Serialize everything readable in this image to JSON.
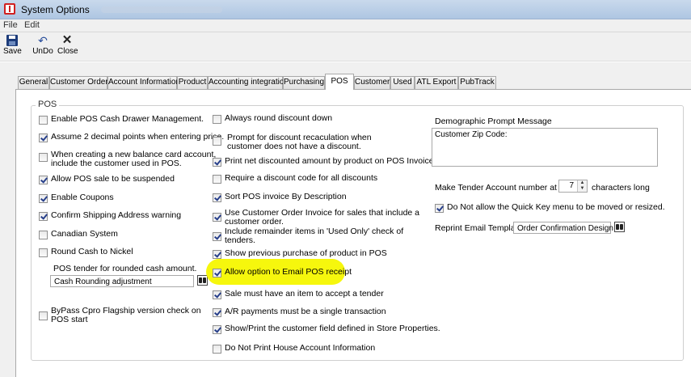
{
  "window": {
    "title": "System Options"
  },
  "menu": [
    "File",
    "Edit"
  ],
  "toolbar": {
    "save": "Save",
    "undo": "UnDo",
    "close": "Close"
  },
  "tabs": [
    "General",
    "Customer Orders",
    "Account Information",
    "Product",
    "Accounting integration",
    "Purchasing",
    "POS",
    "Customer",
    "Used",
    "ATL Export",
    "PubTrack"
  ],
  "active_tab": "POS",
  "group_title": "POS",
  "col1": {
    "enable_drawer": {
      "label": "Enable POS Cash Drawer Management.",
      "checked": false
    },
    "assume_decimal": {
      "label": "Assume 2 decimal points when entering price.",
      "checked": true
    },
    "new_balance_1": "When creating a new balance card account,",
    "new_balance_2": "include the customer used in POS.",
    "allow_suspend": {
      "label": "Allow POS sale to be suspended",
      "checked": true
    },
    "enable_coupons": {
      "label": "Enable Coupons",
      "checked": true
    },
    "confirm_shipping": {
      "label": "Confirm Shipping Address warning",
      "checked": true
    },
    "canadian": {
      "label": "Canadian System",
      "checked": false
    },
    "round_cash": {
      "label": "Round Cash to Nickel",
      "checked": false
    },
    "pos_tender_label": "POS tender for rounded cash amount.",
    "pos_tender_value": "Cash Rounding adjustment",
    "bypass_1": "ByPass Cpro Flagship  version check on",
    "bypass_2": "POS start"
  },
  "col2": {
    "always_round": {
      "label": "Always round discount down",
      "checked": false
    },
    "prompt_discount_1": "Prompt for discount recaculation when",
    "prompt_discount_2": "customer does not have a discount.",
    "print_net": {
      "label": "Print net discounted amount by product on POS Invoice",
      "checked": true
    },
    "require_code": {
      "label": "Require a discount code for all discounts",
      "checked": false
    },
    "sort_invoice": {
      "label": "Sort POS invoice By Description",
      "checked": true
    },
    "use_co_1": "Use Customer Order Invoice for sales  that include a",
    "use_co_2": "customer order.",
    "include_used_1": "Include remainder items in 'Used Only' check of",
    "include_used_2": "tenders.",
    "show_previous": {
      "label": "Show previous purchase of product in POS",
      "checked": true
    },
    "allow_email": {
      "label": "Allow option to Email POS receipt",
      "checked": true
    },
    "sale_must": {
      "label": "Sale must have an item to accept a tender",
      "checked": true
    },
    "ar_payments": {
      "label": "A/R payments must be a single transaction",
      "checked": true
    },
    "show_print": {
      "label": "Show/Print the customer field defined in Store Properties.",
      "checked": true
    },
    "do_not_print": {
      "label": "Do Not Print House Account Information",
      "checked": false
    }
  },
  "col3": {
    "demographic_label": "Demographic Prompt Message",
    "demographic_value": "Customer Zip Code:",
    "tender_prefix": "Make Tender Account number at least",
    "tender_value": "7",
    "tender_suffix": "characters long",
    "quick_key": {
      "label": "Do Not allow the Quick Key menu to be moved or resized.",
      "checked": true
    },
    "reprint_label": "Reprint Email Template",
    "reprint_value": "Order Confirmation Design"
  },
  "icons": {
    "save": "floppy-disk-icon",
    "undo": "undo-icon",
    "close": "close-icon",
    "lookup": "binoculars-icon"
  },
  "colors": {
    "highlight": "#f6f700",
    "titlebar": "#b9cfe8",
    "check": "#273f8a"
  }
}
